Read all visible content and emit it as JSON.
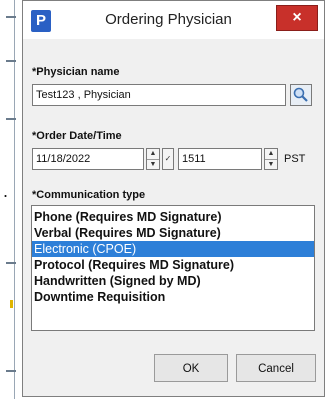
{
  "window": {
    "title": "Ordering Physician",
    "app_icon_letter": "P",
    "close_glyph": "×"
  },
  "physician": {
    "label": "*Physician name",
    "value": "Test123 , Physician"
  },
  "order_datetime": {
    "label": "*Order Date/Time",
    "date_value": "11/18/2022",
    "time_value": "1511",
    "timezone": "PST"
  },
  "communication": {
    "label": "*Communication type",
    "options": [
      "Phone (Requires MD Signature)",
      "Verbal (Requires MD Signature)",
      "Electronic (CPOE)",
      "Protocol (Requires MD Signature)",
      "Handwritten (Signed by MD)",
      "Downtime Requisition"
    ],
    "selected": "Electronic (CPOE)"
  },
  "buttons": {
    "ok": "OK",
    "cancel": "Cancel"
  },
  "colors": {
    "selection": "#2d7fd8",
    "close": "#c8302a",
    "app_icon": "#2a60c4"
  }
}
